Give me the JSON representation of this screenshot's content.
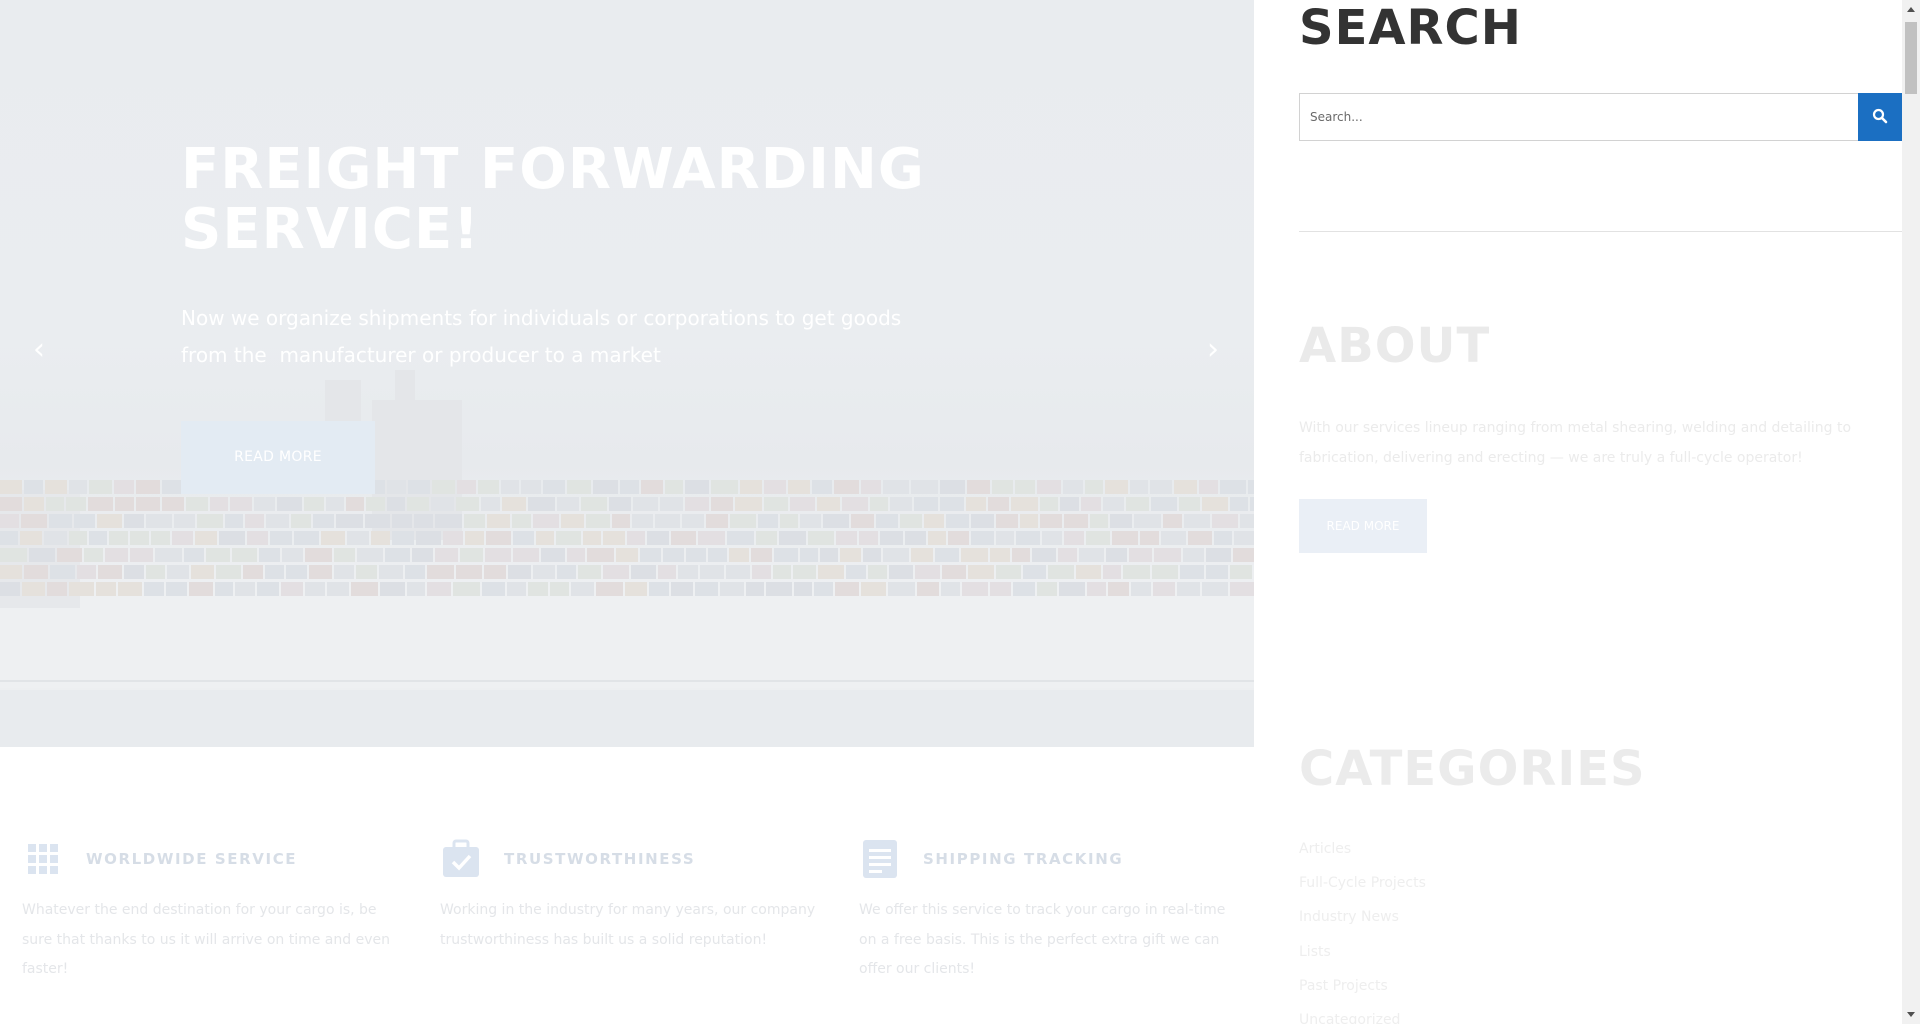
{
  "hero": {
    "title_line1": "FREIGHT FORWARDING",
    "title_line2": "SERVICE!",
    "subtitle_line1": "Now we organize shipments for individuals or corporations to get goods",
    "subtitle_line2": "from the  manufacturer or producer to a market",
    "button_label": "READ MORE",
    "prev_arrow": "‹",
    "next_arrow": "›"
  },
  "features": [
    {
      "title": "WORLDWIDE SERVICE",
      "icon": "grid-icon",
      "text": "Whatever the end destination for your cargo is, be sure that thanks to us it will arrive on time and even faster!"
    },
    {
      "title": "TRUSTWORTHINESS",
      "icon": "briefcase-check-icon",
      "text": "Working in the industry for many years, our company trustworthiness has built us a solid reputation!"
    },
    {
      "title": "SHIPPING TRACKING",
      "icon": "document-list-icon",
      "text": "We offer this service to track your cargo in real-time on a free basis. This is the perfect extra gift we can offer our clients!"
    }
  ],
  "sidebar": {
    "search": {
      "heading": "SEARCH",
      "placeholder": "Search...",
      "button_icon": "search-icon"
    },
    "about": {
      "heading": "ABOUT",
      "text": "With our services lineup ranging from metal shearing, welding and detailing to fabrication, delivering and erecting — we are truly a full-cycle operator!",
      "button_label": "READ MORE"
    },
    "categories": {
      "heading": "CATEGORIES",
      "items": [
        "Articles",
        "Full-Cycle Projects",
        "Industry News",
        "Lists",
        "Past Projects",
        "Uncategorized"
      ]
    }
  },
  "colors": {
    "accent": "#1b6fc2",
    "heading_dark": "#333333"
  }
}
